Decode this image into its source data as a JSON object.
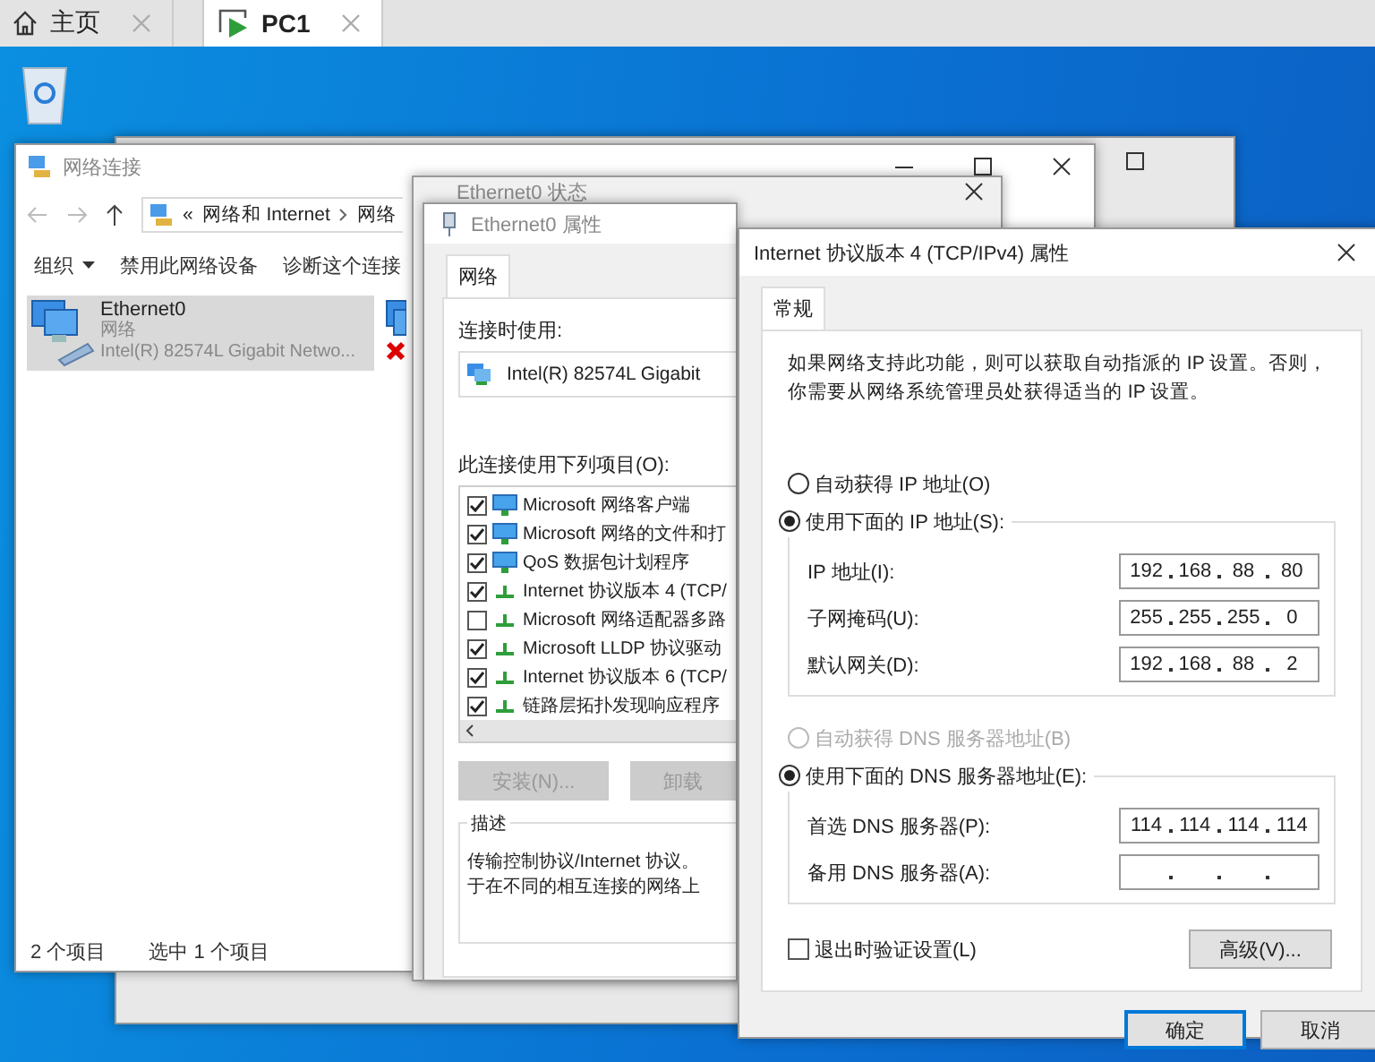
{
  "app_tabs": [
    {
      "label": "主页",
      "kind": "home",
      "selected": false
    },
    {
      "label": "PC1",
      "kind": "vm",
      "selected": true
    }
  ],
  "network_connections": {
    "title": "网络连接",
    "address": {
      "prefix": "«",
      "segments": [
        "网络和 Internet",
        "网络"
      ]
    },
    "toolbar": [
      {
        "label": "组织",
        "dropdown": true
      },
      {
        "label": "禁用此网络设备",
        "dropdown": false
      },
      {
        "label": "诊断这个连接",
        "dropdown": false
      }
    ],
    "adapters": [
      {
        "name": "Ethernet0",
        "network": "网络",
        "device": "Intel(R) 82574L Gigabit Netwo...",
        "selected": true,
        "disconnected": false
      },
      {
        "selected": false,
        "disconnected": true
      }
    ],
    "status_bar": [
      "2 个项目",
      "选中 1 个项目"
    ]
  },
  "status_window": {
    "title": "Ethernet0 状态"
  },
  "properties_window": {
    "title": "Ethernet0 属性",
    "tabs": [
      {
        "label": "网络",
        "selected": true
      }
    ],
    "connect_using_label": "连接时使用:",
    "adapter": "Intel(R) 82574L Gigabit",
    "items_label": "此连接使用下列项目(O):",
    "items": [
      {
        "label": "Microsoft 网络客户端",
        "checked": true,
        "kind": "client"
      },
      {
        "label": "Microsoft 网络的文件和打",
        "checked": true,
        "kind": "client"
      },
      {
        "label": "QoS 数据包计划程序",
        "checked": true,
        "kind": "client"
      },
      {
        "label": "Internet 协议版本 4 (TCP/",
        "checked": true,
        "kind": "protocol"
      },
      {
        "label": "Microsoft 网络适配器多路",
        "checked": false,
        "kind": "protocol"
      },
      {
        "label": "Microsoft LLDP 协议驱动",
        "checked": true,
        "kind": "protocol"
      },
      {
        "label": "Internet 协议版本 6 (TCP/",
        "checked": true,
        "kind": "protocol"
      },
      {
        "label": "链路层拓扑发现响应程序",
        "checked": true,
        "kind": "protocol"
      }
    ],
    "buttons": [
      {
        "label": "安装(N)...",
        "disabled": true
      },
      {
        "label": "卸载",
        "disabled": true
      }
    ],
    "description": {
      "title": "描述",
      "lines": [
        "传输控制协议/Internet 协议。",
        "于在不同的相互连接的网络上"
      ]
    }
  },
  "ipv4_window": {
    "title": "Internet 协议版本 4 (TCP/IPv4) 属性",
    "tabs": [
      {
        "label": "常规",
        "selected": true
      }
    ],
    "intro": "如果网络支持此功能，则可以获取自动指派的 IP 设置。否则，你需要从网络系统管理员处获得适当的 IP 设置。",
    "ip_mode": [
      {
        "label": "自动获得 IP 地址(O)",
        "selected": false,
        "disabled": false
      },
      {
        "label": "使用下面的 IP 地址(S):",
        "selected": true,
        "disabled": false
      }
    ],
    "ip_fields": [
      {
        "label": "IP 地址(I):",
        "octets": [
          "192",
          "168",
          "88",
          "80"
        ]
      },
      {
        "label": "子网掩码(U):",
        "octets": [
          "255",
          "255",
          "255",
          "0"
        ]
      },
      {
        "label": "默认网关(D):",
        "octets": [
          "192",
          "168",
          "88",
          "2"
        ]
      }
    ],
    "dns_mode": [
      {
        "label": "自动获得 DNS 服务器地址(B)",
        "selected": false,
        "disabled": true
      },
      {
        "label": "使用下面的 DNS 服务器地址(E):",
        "selected": true,
        "disabled": false
      }
    ],
    "dns_fields": [
      {
        "label": "首选 DNS 服务器(P):",
        "octets": [
          "114",
          "114",
          "114",
          "114"
        ]
      },
      {
        "label": "备用 DNS 服务器(A):"
      }
    ],
    "validate_on_exit": {
      "label": "退出时验证设置(L)",
      "checked": false
    },
    "advanced_button": "高级(V)...",
    "buttons": [
      {
        "label": "确定",
        "default": true
      },
      {
        "label": "取消",
        "default": false
      }
    ]
  }
}
